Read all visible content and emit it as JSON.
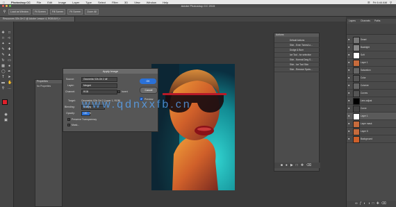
{
  "menubar": {
    "apple": "",
    "app": "Photoshop CC",
    "items": [
      "File",
      "Edit",
      "Image",
      "Layer",
      "Type",
      "Select",
      "Filter",
      "3D",
      "View",
      "Window",
      "Help"
    ],
    "clock": "Fri 6:44 AM"
  },
  "window": {
    "title": "Adobe Photoshop CC 2015"
  },
  "options": {
    "b1": "Load as Window",
    "b2": "Fit Screen",
    "b3": "Fill Screen",
    "b4": "Fit Screen",
    "b5": "Zoom All"
  },
  "document": {
    "tab": "Resources 02b-Ort 2 @ Adobe Lesson 4, RGB/16*) ×"
  },
  "properties": {
    "title": "Properties",
    "subtitle": "No Properties"
  },
  "dialog": {
    "title": "Apply Image",
    "source_label": "Source:",
    "source_value": "Geometric 02b-Ort 2 dif",
    "layer_label": "Layer:",
    "layer_value": "Merged",
    "channel_label": "Channel:",
    "channel_value": "RGB",
    "invert_label": "Invert",
    "target_label": "Target:",
    "target_value": "Geometric 02b Ort 2 (Layer 1, RGB)",
    "blending_label": "Blending:",
    "blending_value": "Multiply",
    "opacity_label": "Opacity:",
    "opacity_value": "100",
    "opacity_unit": "%",
    "preserve_label": "Preserve Transparency",
    "mask_label": "Mask...",
    "ok": "OK",
    "cancel": "Cancel",
    "preview_label": "Preview"
  },
  "watermark": "www.qdnxxfb.cn",
  "actions": {
    "title": "Actions",
    "items": [
      "Default Actions",
      "Skin - Even Tones/Lo...",
      "Dodge & Burn",
      "Ice Tool - for selective",
      "Skin - Normal Drag S...",
      "Skin - Ice Tool Skin",
      "Skin - Remove Spots..."
    ]
  },
  "layers": {
    "tabs": [
      "Layers",
      "Channels",
      "Paths"
    ],
    "rows": [
      "Smart",
      "Backlight",
      "Soft",
      "Layer 1",
      "Saturation",
      "Color",
      "Colorize",
      "Curves",
      "Lens adjust",
      "Curve",
      "Layer 1",
      "Layer mask",
      "Layer 5",
      "Background"
    ]
  },
  "colors": {
    "accent": "#2a71d8",
    "foreground": "#e0202a",
    "background": "#ffffff"
  }
}
